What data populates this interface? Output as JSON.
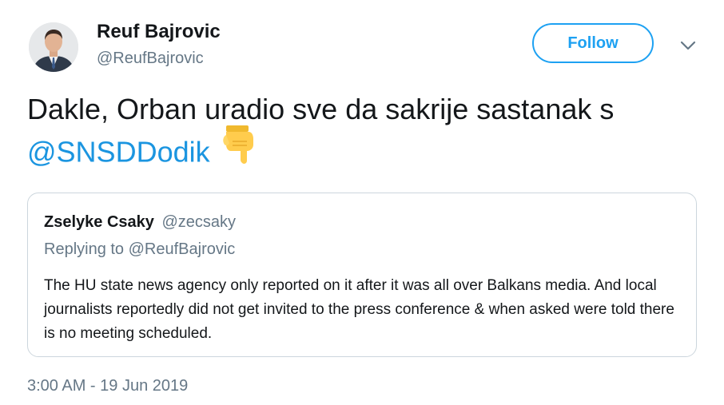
{
  "author": {
    "name": "Reuf Bajrovic",
    "handle": "@ReufBajrovic"
  },
  "actions": {
    "follow_label": "Follow",
    "more_icon": "chevron-down-icon"
  },
  "tweet": {
    "text_line1": "Dakle, Orban uradio sve da sakrije sastanak s",
    "mention": "@SNSDDodik",
    "emoji": "backhand-index-pointing-down-icon"
  },
  "quote": {
    "name": "Zselyke Csaky",
    "handle": "@zecsaky",
    "replying_to": "Replying to @ReufBajrovic",
    "body": "The HU state news agency only reported on it after it was all over Balkans media. And local journalists reportedly did not get invited to the press conference & when asked were told there is no meeting scheduled."
  },
  "timestamp": "3:00 AM - 19 Jun 2019",
  "colors": {
    "accent": "#1da1f2",
    "mention": "#1b95e0",
    "muted": "#657786",
    "text": "#14171a",
    "border": "#ccd6dd"
  }
}
